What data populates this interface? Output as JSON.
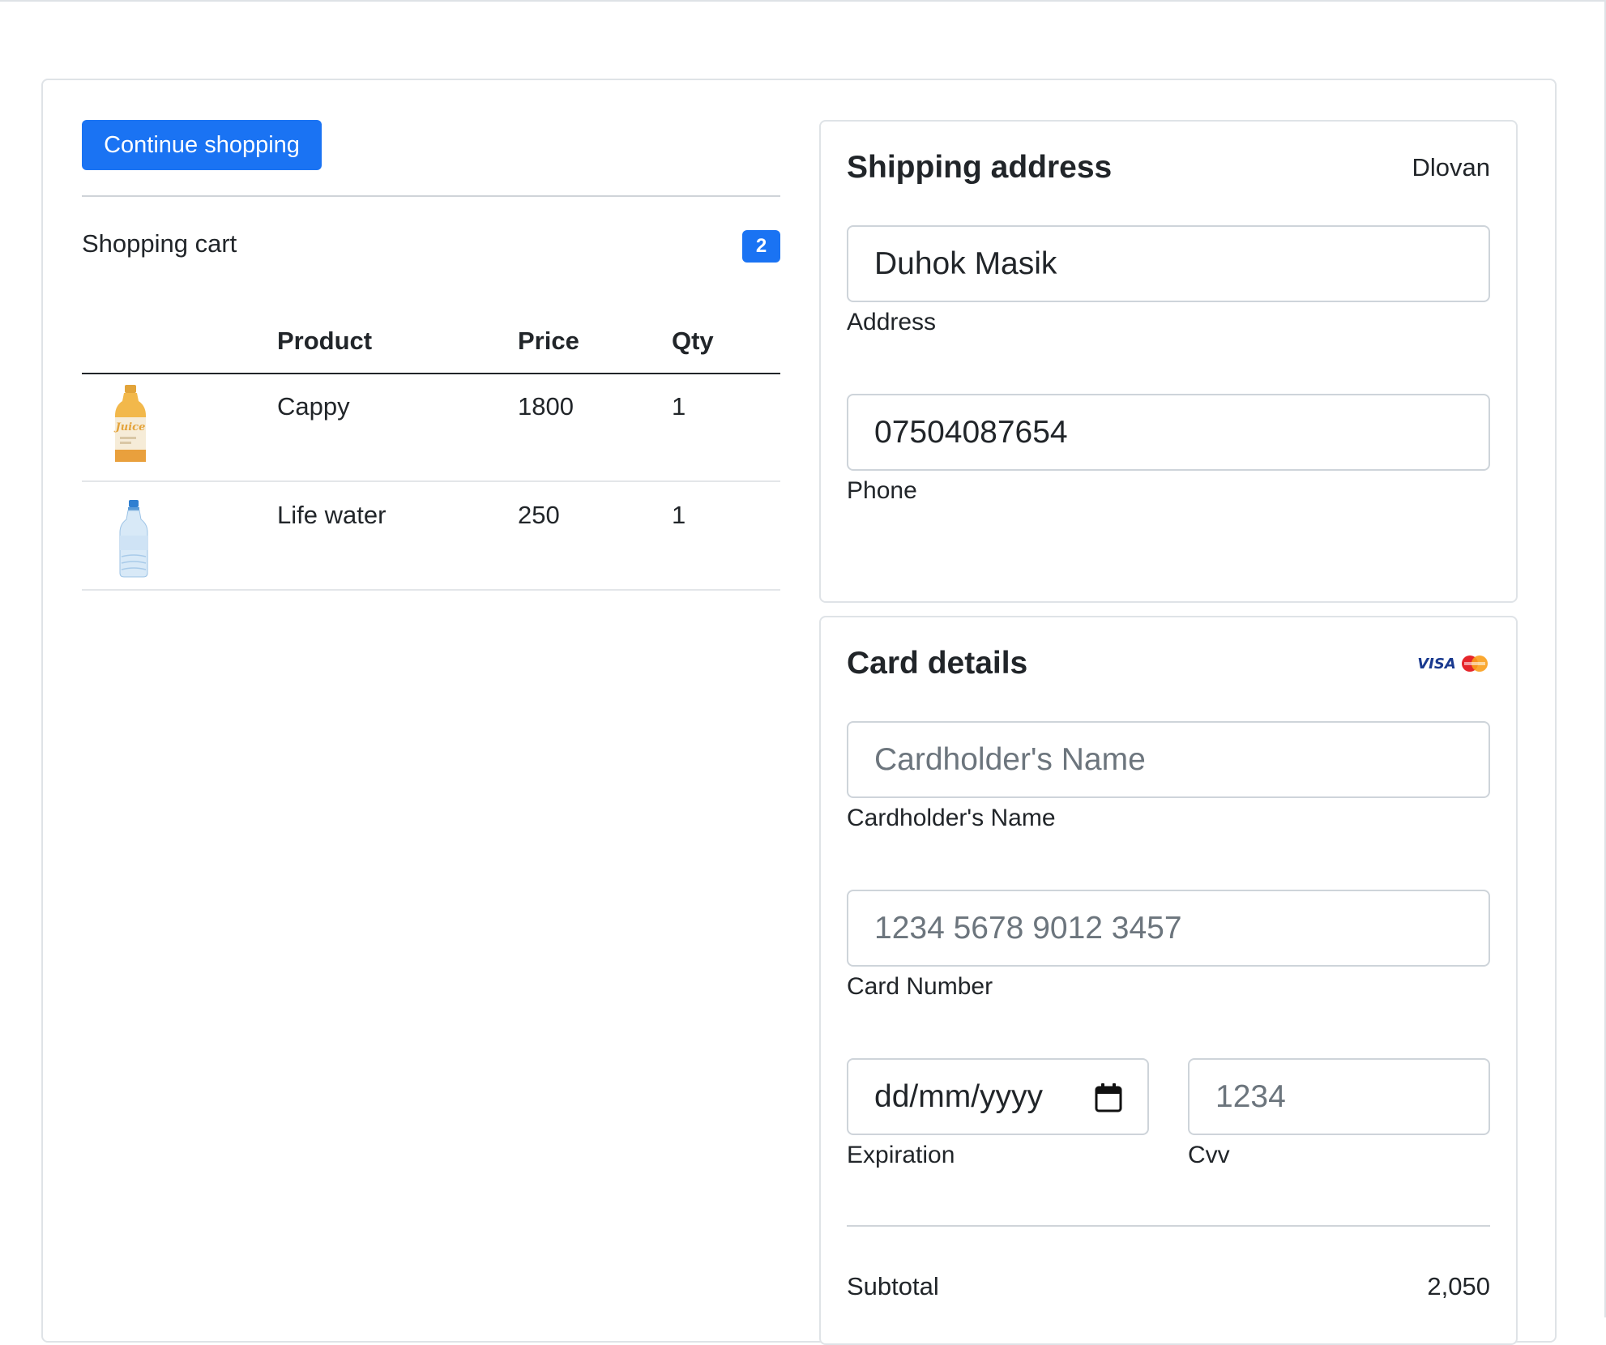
{
  "left": {
    "continue_label": "Continue shopping",
    "cart_title": "Shopping cart",
    "cart_count": "2",
    "table": {
      "headers": {
        "product": "Product",
        "price": "Price",
        "qty": "Qty"
      },
      "rows": [
        {
          "product": "Cappy",
          "price": "1800",
          "qty": "1",
          "image_icon": "juice-bottle-image"
        },
        {
          "product": "Life water",
          "price": "250",
          "qty": "1",
          "image_icon": "water-bottle-image"
        }
      ]
    }
  },
  "shipping": {
    "title": "Shipping address",
    "user": "Dlovan",
    "address_value": "Duhok Masik",
    "address_label": "Address",
    "phone_value": "07504087654",
    "phone_label": "Phone"
  },
  "card": {
    "title": "Card details",
    "brand_icons": [
      "visa-icon",
      "mastercard-icon"
    ],
    "visa_text": "VISA",
    "name_placeholder": "Cardholder's Name",
    "name_label": "Cardholder's Name",
    "number_placeholder": "1234 5678 9012 3457",
    "number_label": "Card Number",
    "expiration_value": "dd/mm/yyyy",
    "expiration_label": "Expiration",
    "cvv_placeholder": "1234",
    "cvv_label": "Cvv"
  },
  "summary": {
    "subtotal_label": "Subtotal",
    "subtotal_value": "2,050"
  },
  "colors": {
    "primary": "#1a73f3",
    "text": "#212529",
    "placeholder": "#6c757d",
    "border": "#ced4da"
  }
}
